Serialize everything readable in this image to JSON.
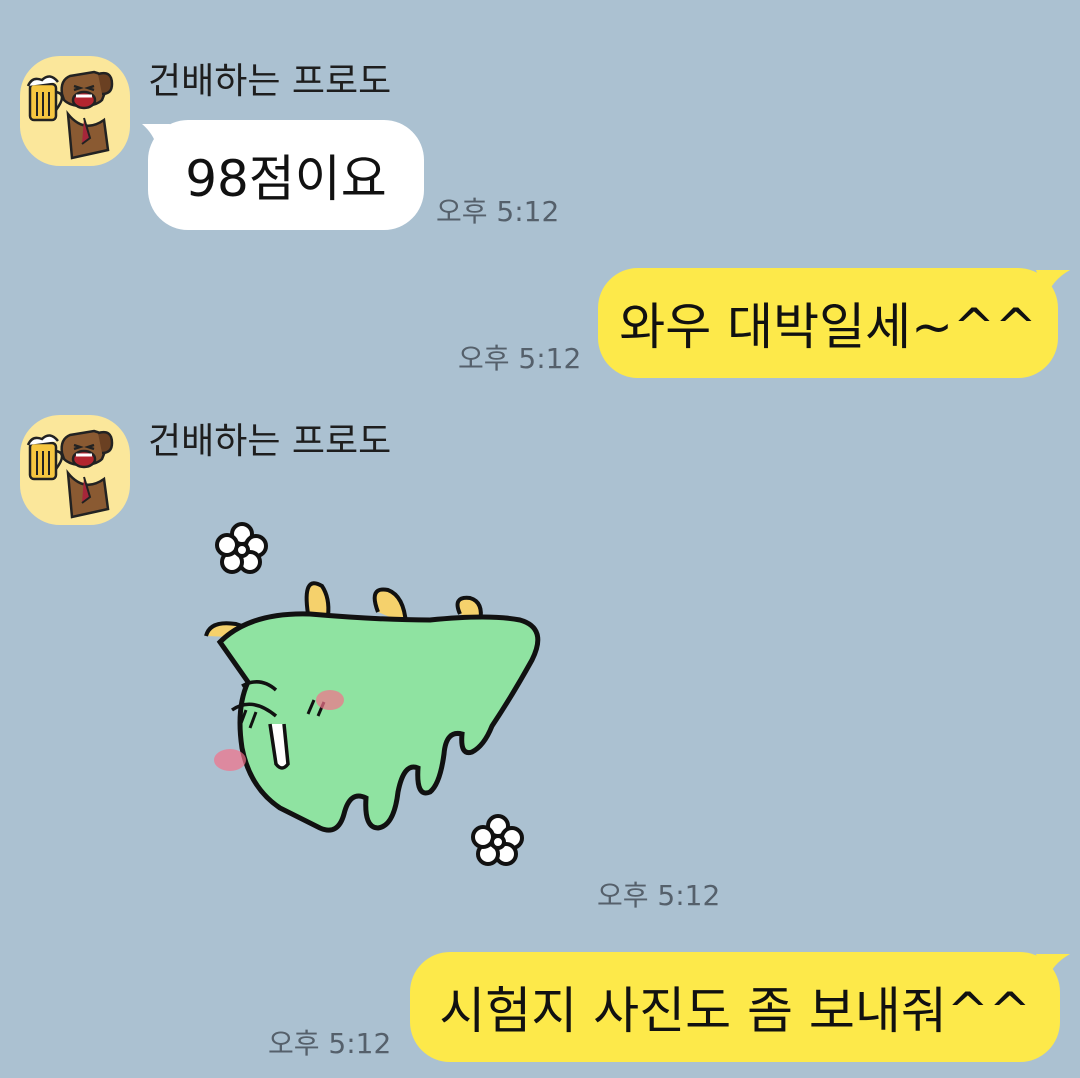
{
  "chat": {
    "messages": [
      {
        "sender": "건배하는 프로도",
        "text": "98점이요",
        "time": "오후 5:12"
      },
      {
        "text": "와우 대박일세~^^",
        "time": "오후 5:12"
      },
      {
        "sender": "건배하는 프로도",
        "sticker": "green-dragon-sticker",
        "time": "오후 5:12"
      },
      {
        "text": "시험지 사진도 좀 보내줘^^",
        "time": "오후 5:12"
      }
    ]
  },
  "colors": {
    "background": "#abc1d1",
    "incoming_bubble": "#ffffff",
    "outgoing_bubble": "#fde94a",
    "avatar_bg": "#fbe79b",
    "timestamp": "#55606b"
  },
  "icons": [
    "frodo-beer-avatar-icon",
    "green-dragon-sticker"
  ]
}
